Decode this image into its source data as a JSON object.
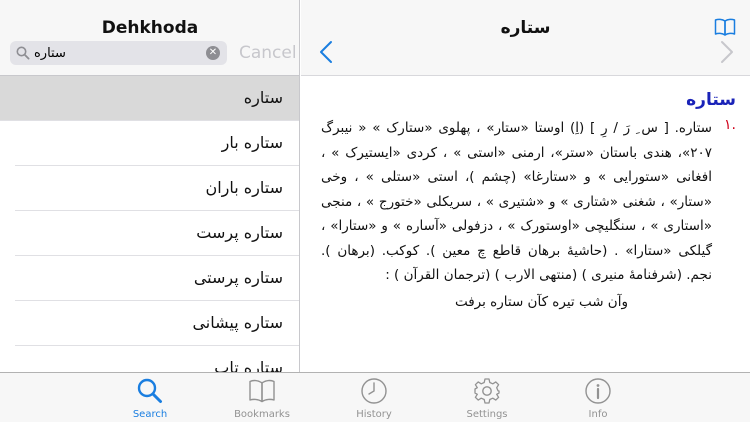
{
  "sidebar": {
    "title": "Dehkhoda",
    "search": {
      "value": "ستاره",
      "placeholder": ""
    },
    "cancel_label": "Cancel",
    "results": [
      {
        "label": "ستاره"
      },
      {
        "label": "ستاره بار"
      },
      {
        "label": "ستاره باران"
      },
      {
        "label": "ستاره پرست"
      },
      {
        "label": "ستاره پرستی"
      },
      {
        "label": "ستاره پیشانی"
      },
      {
        "label": "ستاره تاب"
      }
    ]
  },
  "detail": {
    "title": "ستاره",
    "headword": "ستاره",
    "definition_number": ".۱",
    "definition": "ستاره. [ س ِ رَ / رِ ] (اِ) اوستا «ستار» ، پهلوی «ستارک » « نیبرگ ۲۰۷»، هندی باستان «ستر»، ارمنی «استی » ، کردی «ایستیرک » ، افغانی «ستورایی » و «ستارغا» (چشم )، استی «ستلی » ، وخی «ستار» ، شغنی «شتاری » و «شتیری » ، سریکلی «ختورج » ، منجی «استاری » ، سنگلیچی «اوستورک » ، دزفولی «آساره » و «ستارا» ، گیلکی «ستارا» . (حاشیهٔ برهان قاطع چ معین ). کوکب. (برهان ). نجم. (شرفنامهٔ منیری ) (منتهی الارب ) (ترجمان القرآن ) :",
    "quote": "وآن شب تیره کآن ستاره برفت"
  },
  "tabs": [
    {
      "label": "Search",
      "icon": "search-icon",
      "active": true
    },
    {
      "label": "Bookmarks",
      "icon": "book-icon",
      "active": false
    },
    {
      "label": "History",
      "icon": "clock-icon",
      "active": false
    },
    {
      "label": "Settings",
      "icon": "gear-icon",
      "active": false
    },
    {
      "label": "Info",
      "icon": "info-icon",
      "active": false
    }
  ],
  "colors": {
    "accent": "#1a7ee0",
    "headword": "#1a23b8",
    "number": "#d0021b"
  }
}
